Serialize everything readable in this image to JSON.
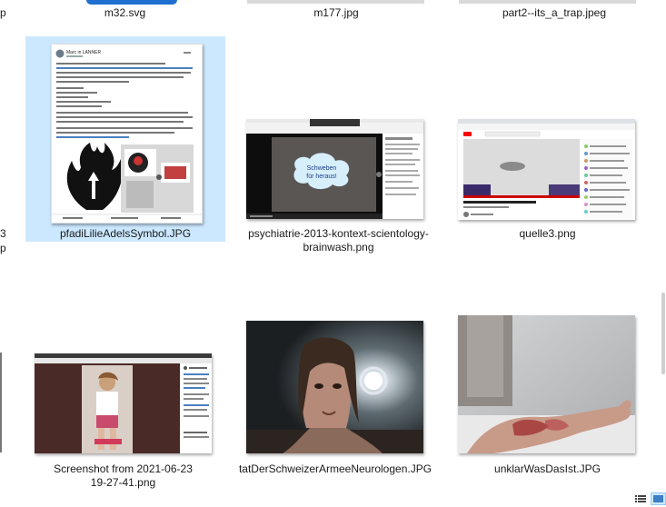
{
  "files_row0": [
    "m32.svg",
    "m177.jpg",
    "part2--its_a_trap.jpeg"
  ],
  "left_edge_fragments": {
    "row0": "p",
    "row1_line1": "3",
    "row1_line2": "p"
  },
  "items": [
    {
      "name_line1": "pfadiLilieAdelsSymbol.JPG",
      "name_line2": "",
      "selected": true
    },
    {
      "name_line1": "psychiatrie-2013-kontext-scientology-",
      "name_line2": "brainwash.png",
      "selected": false
    },
    {
      "name_line1": "quelle3.png",
      "name_line2": "",
      "selected": false
    },
    {
      "name_line1": "Screenshot from 2021-06-23",
      "name_line2": "19-27-41.png",
      "selected": false
    },
    {
      "name_line1": "tatDerSchweizerArmeeNeurologen.JPG",
      "name_line2": "",
      "selected": false
    },
    {
      "name_line1": "unklarWasDasIst.JPG",
      "name_line2": "",
      "selected": false
    }
  ],
  "thumb_text": {
    "fb_name": "Marc in LANNER",
    "cloud_text_line1": "Schweben",
    "cloud_text_line2": "für heraus!"
  },
  "colors": {
    "selection": "#cce8ff",
    "accent_youtube": "#ff0000"
  },
  "view_icons": [
    "details-view-icon",
    "large-icons-view-icon"
  ]
}
